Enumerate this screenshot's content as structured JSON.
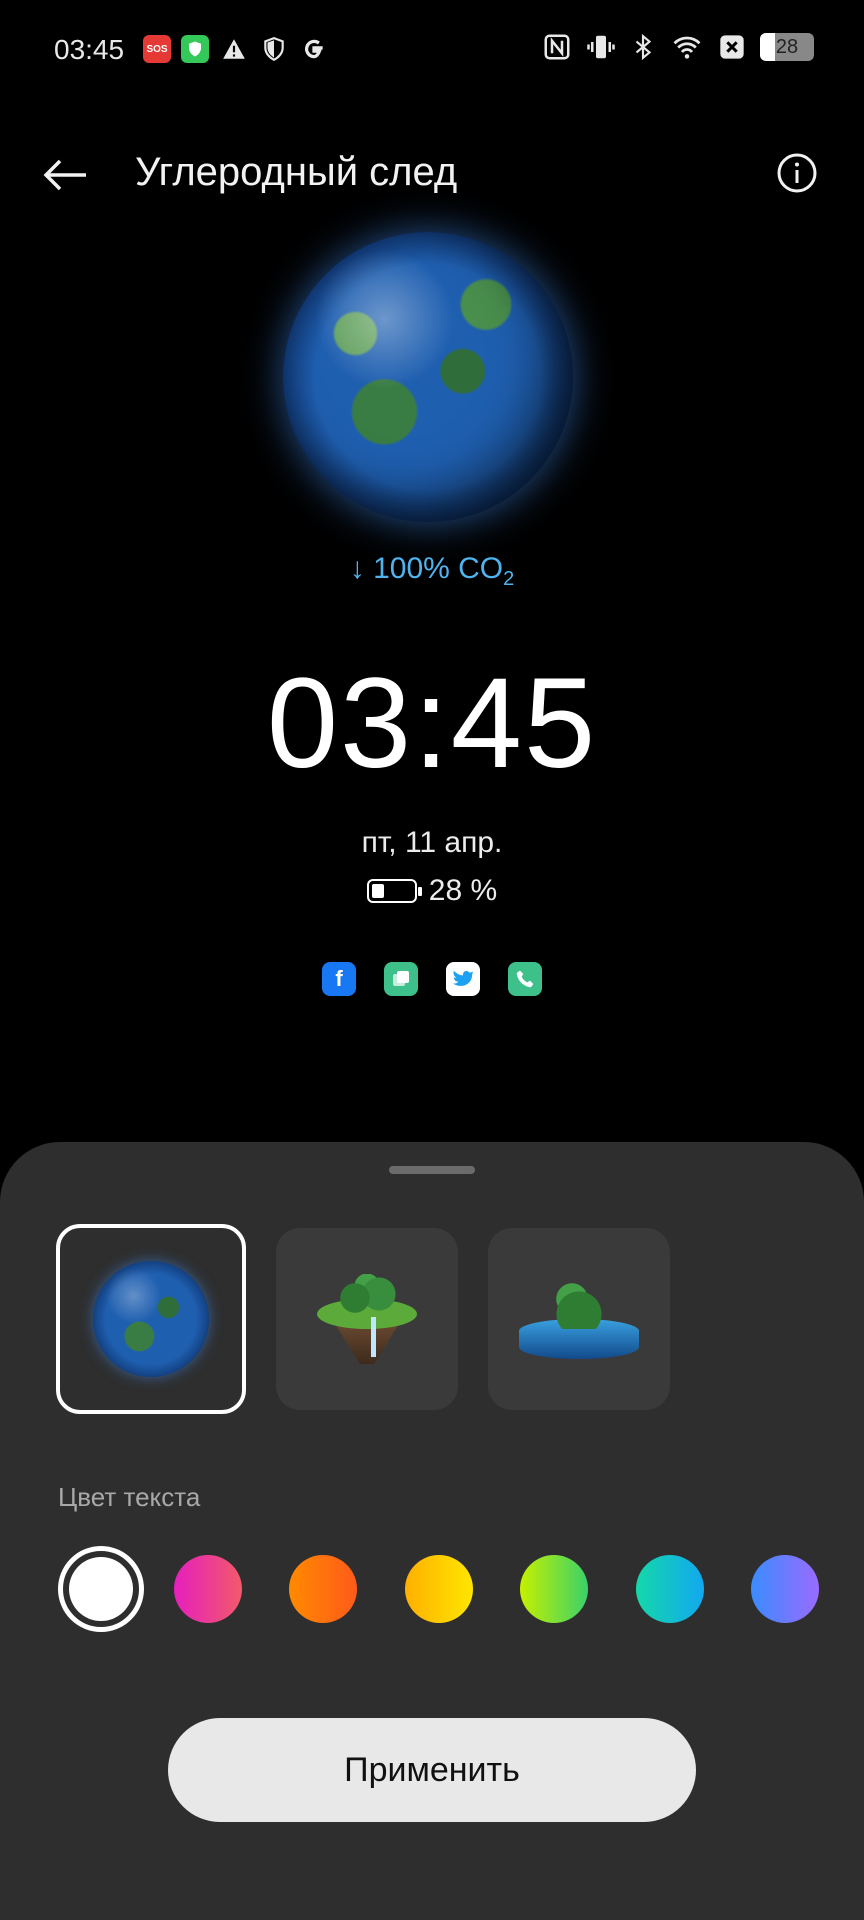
{
  "status_bar": {
    "time": "03:45",
    "left_icons": [
      "sos-icon",
      "shield-green-icon",
      "warning-icon",
      "shield-outline-icon",
      "google-icon"
    ],
    "right_icons": [
      "nfc-icon",
      "vibrate-icon",
      "bluetooth-icon",
      "wifi-icon",
      "x-icon"
    ],
    "battery": "28"
  },
  "header": {
    "title": "Углеродный след"
  },
  "preview": {
    "co2_text": "↓ 100% CO",
    "co2_sub": "2",
    "clock": "03:45",
    "date": "пт, 11 апр.",
    "battery_percent": "28 %",
    "battery_level": 0.28,
    "app_icons": [
      {
        "name": "facebook-icon",
        "color": "#1877f2",
        "glyph": "f"
      },
      {
        "name": "gallery-icon",
        "color": "#3ec08a",
        "glyph": "▣"
      },
      {
        "name": "twitter-icon",
        "color": "#ffffff",
        "glyph": "🐦"
      },
      {
        "name": "phone-icon",
        "color": "#3ec08a",
        "glyph": "✆"
      }
    ]
  },
  "sheet": {
    "color_label": "Цвет текста",
    "colors": [
      "#ffffff",
      "#e8399d",
      "#ff6d1a",
      "#ffc300",
      "#7bdc3a",
      "#13c6d4",
      "#6a7bff"
    ],
    "apply_label": "Применить"
  },
  "accent": "#4fb4ee"
}
